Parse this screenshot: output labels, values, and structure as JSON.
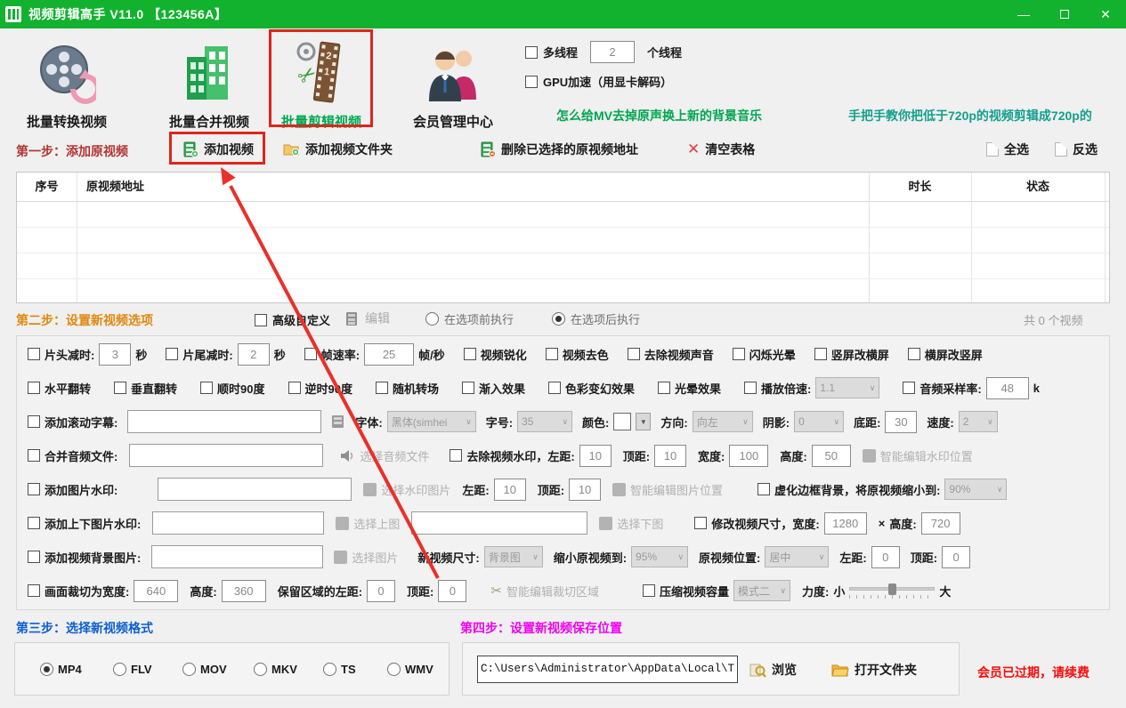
{
  "titlebar": {
    "title": "视频剪辑高手 V11.0 【123456A】"
  },
  "toolbar": {
    "items": [
      {
        "label": "批量转换视频"
      },
      {
        "label": "批量合并视频"
      },
      {
        "label": "批量剪辑视频"
      },
      {
        "label": "会员管理中心"
      }
    ],
    "multithread": "多线程",
    "thread_suffix": "个线程",
    "gpu": "GPU加速（用显卡解码）",
    "link_left": "怎么给MV去掉原声换上新的背景音乐",
    "link_right": "手把手教你把低于720p的视频剪辑成720p的"
  },
  "step1": {
    "title": "第一步：添加原视频",
    "add_video": "添加视频",
    "add_folder": "添加视频文件夹",
    "delete_selected": "删除已选择的原视频地址",
    "clear_table": "清空表格",
    "select_all": "全选",
    "invert_sel": "反选"
  },
  "table": {
    "headers": [
      "序号",
      "原视频地址",
      "时长",
      "状态"
    ]
  },
  "step2": {
    "title": "第二步：设置新视频选项",
    "advanced": "高级自定义",
    "edit": "编辑",
    "before": "在选项前执行",
    "after": "在选项后执行",
    "count": "共 0 个视频"
  },
  "t": {
    "trim_head": "片头减时:",
    "sec1": "秒",
    "trim_tail": "片尾减时:",
    "sec2": "秒",
    "framerate": "帧速率:",
    "fps": "帧/秒",
    "sharpen": "视频锐化",
    "decolor": "视频去色",
    "mute": "去除视频声音",
    "flicker": "闪烁光晕",
    "p2l": "竖屏改横屏",
    "l2p": "横屏改竖屏",
    "fliph": "水平翻转",
    "flipv": "垂直翻转",
    "cw90": "顺时90度",
    "ccw90": "逆时90度",
    "randtrans": "随机转场",
    "fadein": "渐入效果",
    "colorfx": "色彩变幻效果",
    "halo": "光晕效果",
    "speed": "播放倍速:",
    "samplerate": "音频采样率:",
    "k": "k",
    "subtitle": "添加滚动字幕:",
    "font": "字体:",
    "fontsize": "字号:",
    "color": "颜色:",
    "direction": "方向:",
    "shadow": "阴影:",
    "bottom": "底距:",
    "subspeed": "速度:",
    "merge_audio": "合并音频文件:",
    "choose_audio": "选择音频文件",
    "remove_wm": "去除视频水印，左距:",
    "top1": "顶距:",
    "width1": "宽度:",
    "height1": "高度:",
    "smart_wm": "智能编辑水印位置",
    "img_wm": "添加图片水印:",
    "choose_wm_img": "选择水印图片",
    "left2": "左距:",
    "top2": "顶距:",
    "smart_img": "智能编辑图片位置",
    "blur_bg": "虚化边框背景，将原视频缩小到:",
    "tb_wm": "添加上下图片水印:",
    "choose_top": "选择上图",
    "choose_bottom": "选择下图",
    "resize": "修改视频尺寸，宽度:",
    "times": "×",
    "height2": "高度:",
    "bg_img": "添加视频背景图片:",
    "choose_img": "选择图片",
    "new_size": "新视频尺寸:",
    "shrink": "缩小原视频到:",
    "pos": "原视频位置:",
    "left3": "左距:",
    "top3": "顶距:",
    "crop": "画面裁切为宽度:",
    "height3": "高度:",
    "keep_left": "保留区域的左距:",
    "top4": "顶距:",
    "smart_crop": "智能编辑裁切区域",
    "compress": "压缩视频容量",
    "strength": "力度:",
    "small": "小",
    "big": "大"
  },
  "v": {
    "threads": "2",
    "trim_head": "3",
    "trim_tail": "2",
    "framerate": "25",
    "speed": "1.1",
    "samplerate": "48",
    "font": "黑体(simhei",
    "fontsize": "35",
    "dir": "向左",
    "shadow": "0",
    "bottom": "30",
    "subspeed": "2",
    "wm_left": "10",
    "wm_top": "10",
    "wm_w": "100",
    "wm_h": "50",
    "img_left": "10",
    "img_top": "10",
    "blur": "90%",
    "res_w": "1280",
    "res_h": "720",
    "bg_size": "背景图",
    "bg_shrink": "95%",
    "bg_pos": "居中",
    "bg_left": "0",
    "bg_top": "0",
    "crop_w": "640",
    "crop_h": "360",
    "crop_left": "0",
    "crop_top": "0",
    "comp_mode": "模式二"
  },
  "step3": {
    "title": "第三步：选择新视频格式",
    "formats": [
      "MP4",
      "FLV",
      "MOV",
      "MKV",
      "TS",
      "WMV"
    ],
    "selected": "MP4"
  },
  "step4": {
    "title": "第四步：设置新视频保存位置",
    "path": "C:\\Users\\Administrator\\AppData\\Local\\T",
    "browse": "浏览",
    "open_folder": "打开文件夹"
  },
  "footer": {
    "expired": "会员已过期，请续费"
  }
}
